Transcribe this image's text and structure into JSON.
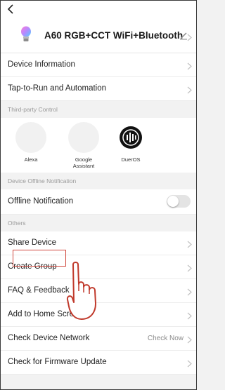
{
  "device": {
    "name": "A60 RGB+CCT WiFi+Bluetooth"
  },
  "rows_top": [
    {
      "label": "Device Information"
    },
    {
      "label": "Tap-to-Run and Automation"
    }
  ],
  "sections": {
    "third_party": "Third-party Control",
    "offline": "Device Offline Notification",
    "others": "Others"
  },
  "third_party": [
    {
      "label": "Alexa",
      "icon": "alexa-icon"
    },
    {
      "label": "Google Assistant",
      "icon": "google-assistant-icon"
    },
    {
      "label": "DuerOS",
      "icon": "dueros-icon"
    }
  ],
  "offline_notification": {
    "label": "Offline Notification",
    "enabled": false
  },
  "others": [
    {
      "label": "Share Device",
      "trail": ""
    },
    {
      "label": "Create Group",
      "trail": ""
    },
    {
      "label": "FAQ & Feedback",
      "trail": ""
    },
    {
      "label": "Add to Home Screen",
      "trail": ""
    },
    {
      "label": "Check Device Network",
      "trail": "Check Now"
    },
    {
      "label": "Check for Firmware Update",
      "trail": ""
    }
  ],
  "colors": {
    "highlight": "#d0463c",
    "background": "#f2f2f2",
    "text": "#222222"
  }
}
